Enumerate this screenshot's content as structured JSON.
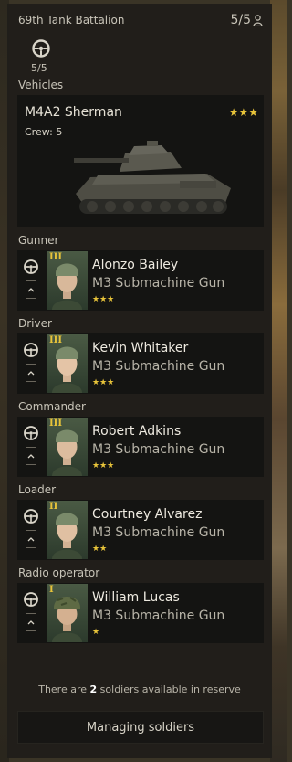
{
  "header": {
    "title": "69th Tank Battalion",
    "count": "5/5"
  },
  "vehicle_slots": {
    "count": "5/5"
  },
  "labels": {
    "vehicles": "Vehicles"
  },
  "vehicle": {
    "name": "M4A2 Sherman",
    "crew": "Crew: 5",
    "stars": "★★★"
  },
  "crew": [
    {
      "role": "Gunner",
      "tier": "III",
      "name": "Alonzo Bailey",
      "weapon": "M3 Submachine Gun",
      "stars": "★★★"
    },
    {
      "role": "Driver",
      "tier": "III",
      "name": "Kevin Whitaker",
      "weapon": "M3 Submachine Gun",
      "stars": "★★★"
    },
    {
      "role": "Commander",
      "tier": "III",
      "name": "Robert Adkins",
      "weapon": "M3 Submachine Gun",
      "stars": "★★★"
    },
    {
      "role": "Loader",
      "tier": "II",
      "name": "Courtney Alvarez",
      "weapon": "M3 Submachine Gun",
      "stars": "★★"
    },
    {
      "role": "Radio operator",
      "tier": "I",
      "name": "William Lucas",
      "weapon": "M3 Submachine Gun",
      "stars": "★"
    }
  ],
  "reserve": {
    "prefix": "There are",
    "number": "2",
    "suffix": "soldiers available in reserve"
  },
  "manage_button": "Managing soldiers",
  "colors": {
    "accent_gold": "#e8c43a",
    "panel": "#201e1a",
    "card": "#141412"
  }
}
